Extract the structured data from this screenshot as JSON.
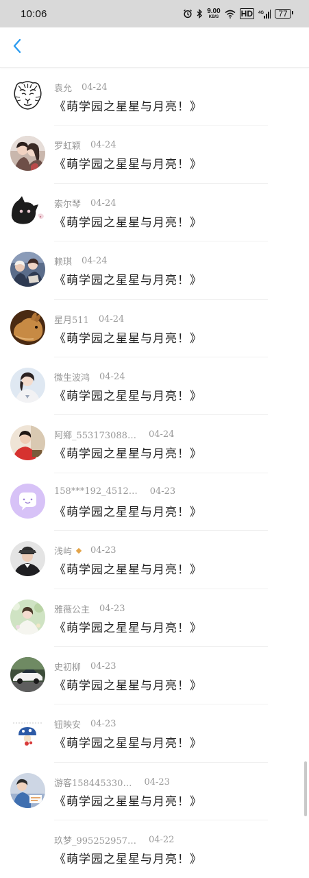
{
  "status_bar": {
    "time": "10:06",
    "network_speed": "9.00",
    "network_speed_unit": "KB/S",
    "hd": "HD",
    "signal_type": "4G",
    "battery": "77",
    "icons": [
      "alarm-icon",
      "bluetooth-icon",
      "wifi-icon",
      "hd-icon",
      "signal-icon",
      "battery-icon"
    ]
  },
  "nav": {
    "back_icon": "chevron-left-icon",
    "accent_color": "#2d9cf0"
  },
  "colors": {
    "name_text": "#999999",
    "message_text": "#222222",
    "badge": "#e3a44a"
  },
  "messages": [
    {
      "name": "袁允",
      "date": "04-24",
      "text": "《萌学园之星星与月亮！》",
      "avatar": "tiger-sketch-avatar"
    },
    {
      "name": "罗虹颖",
      "date": "04-24",
      "text": "《萌学园之星星与月亮！》",
      "avatar": "couple-photo-avatar"
    },
    {
      "name": "索尔琴",
      "date": "04-24",
      "text": "《萌学园之星星与月亮！》",
      "avatar": "cat-avatar"
    },
    {
      "name": "赖琪",
      "date": "04-24",
      "text": "《萌学园之星星与月亮！》",
      "avatar": "group-photo-avatar"
    },
    {
      "name": "星月511",
      "date": "04-24",
      "text": "《萌学园之星星与月亮！》",
      "avatar": "rabbit-avatar"
    },
    {
      "name": "微生波鸿",
      "date": "04-24",
      "text": "《萌学园之星星与月亮！》",
      "avatar": "girl-photo-avatar"
    },
    {
      "name": "阿鄉_553173088…",
      "date": "04-24",
      "text": "《萌学园之星星与月亮！》",
      "avatar": "child-photo-avatar"
    },
    {
      "name": "158***192_4512…",
      "date": "04-23",
      "text": "《萌学园之星星与月亮！》",
      "avatar": "default-chat-avatar"
    },
    {
      "name": "浅屿",
      "date": "04-23",
      "text": "《萌学园之星星与月亮！》",
      "avatar": "man-photo-avatar",
      "badge": true
    },
    {
      "name": "雅薇公主",
      "date": "04-23",
      "text": "《萌学园之星星与月亮！》",
      "avatar": "flower-girl-avatar"
    },
    {
      "name": "史初柳",
      "date": "04-23",
      "text": "《萌学园之星星与月亮！》",
      "avatar": "sports-car-avatar"
    },
    {
      "name": "钮映安",
      "date": "04-23",
      "text": "《萌学园之星星与月亮！》",
      "avatar": "cartoon-mushroom-avatar"
    },
    {
      "name": "游客158445330…",
      "date": "04-23",
      "text": "《萌学园之星星与月亮！》",
      "avatar": "kid-drawing-avatar"
    },
    {
      "name": "玖梦_995252957…",
      "date": "04-22",
      "text": "《萌学园之星星与月亮！》",
      "avatar": "blank-avatar"
    }
  ]
}
